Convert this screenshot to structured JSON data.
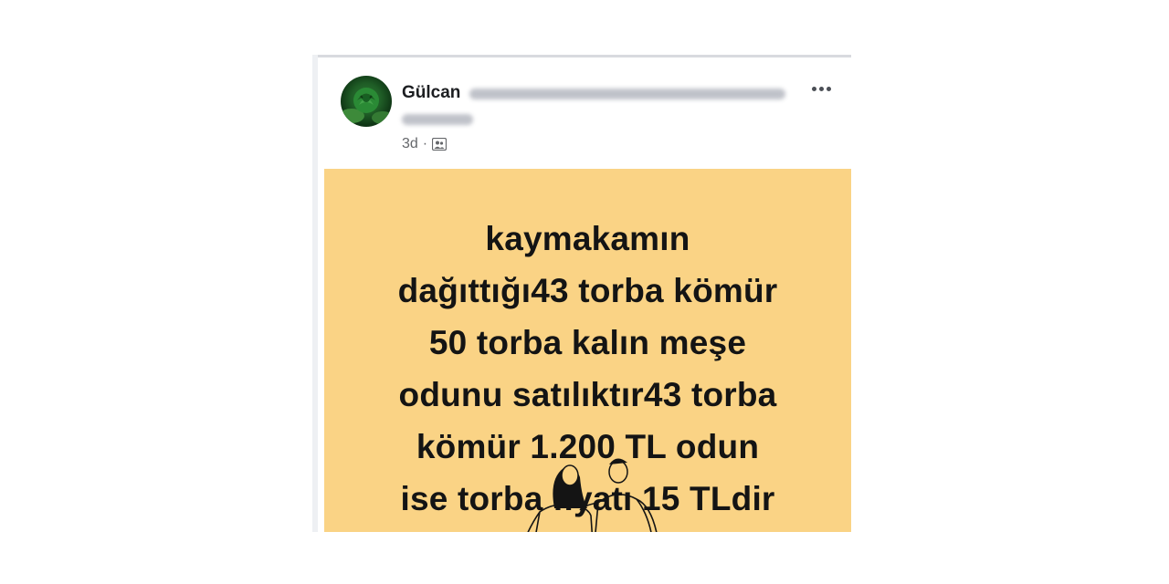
{
  "post": {
    "author": "Gülcan",
    "time": "3d",
    "separator": "·",
    "audience_icon": "group-icon",
    "text_lines": [
      "kaymakamın",
      "dağıttığı43 torba kömür",
      "50 torba kalın meşe",
      "odunu satılıktır43 torba",
      "kömür 1.200 TL odun",
      "ise torba fiyatı 15 TLdir"
    ],
    "background_color": "#fad385"
  }
}
